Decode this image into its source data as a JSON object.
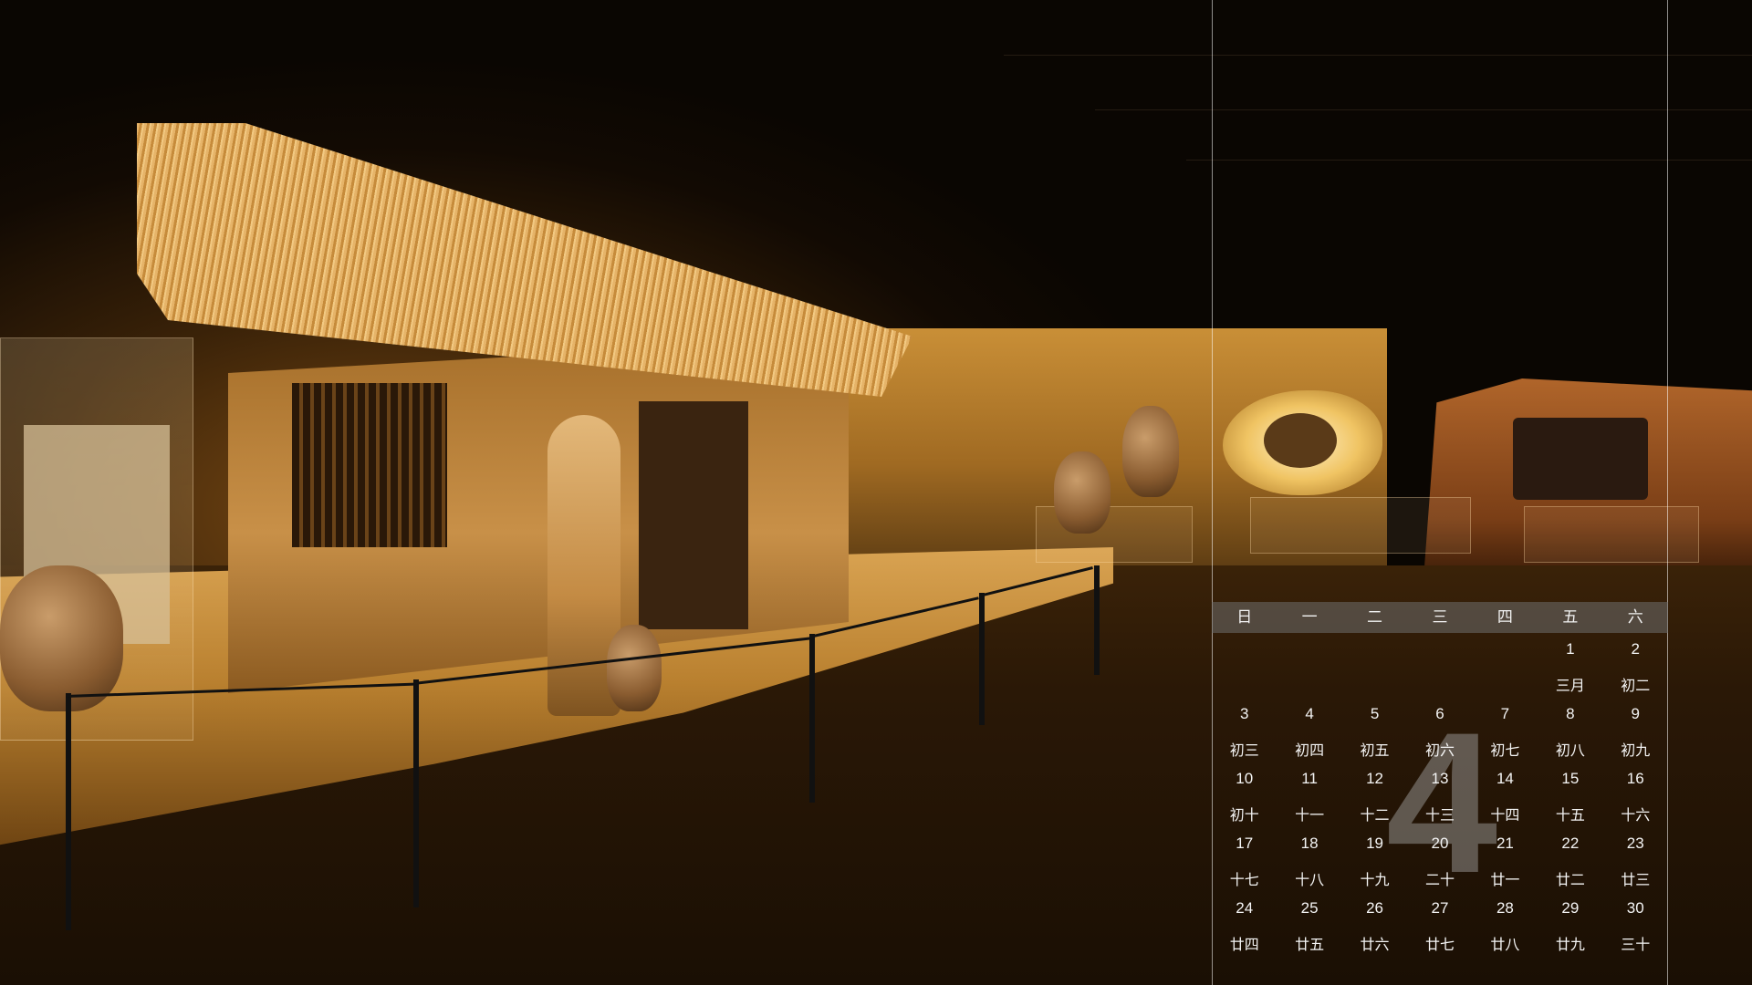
{
  "calendar": {
    "month_number": "4",
    "weekdays": [
      "日",
      "一",
      "二",
      "三",
      "四",
      "五",
      "六"
    ],
    "weeks": [
      [
        {
          "day": "",
          "lunar": ""
        },
        {
          "day": "",
          "lunar": ""
        },
        {
          "day": "",
          "lunar": ""
        },
        {
          "day": "",
          "lunar": ""
        },
        {
          "day": "",
          "lunar": ""
        },
        {
          "day": "1",
          "lunar": "三月"
        },
        {
          "day": "2",
          "lunar": "初二"
        }
      ],
      [
        {
          "day": "3",
          "lunar": "初三"
        },
        {
          "day": "4",
          "lunar": "初四"
        },
        {
          "day": "5",
          "lunar": "初五"
        },
        {
          "day": "6",
          "lunar": "初六"
        },
        {
          "day": "7",
          "lunar": "初七"
        },
        {
          "day": "8",
          "lunar": "初八"
        },
        {
          "day": "9",
          "lunar": "初九"
        }
      ],
      [
        {
          "day": "10",
          "lunar": "初十"
        },
        {
          "day": "11",
          "lunar": "十一"
        },
        {
          "day": "12",
          "lunar": "十二"
        },
        {
          "day": "13",
          "lunar": "十三"
        },
        {
          "day": "14",
          "lunar": "十四"
        },
        {
          "day": "15",
          "lunar": "十五"
        },
        {
          "day": "16",
          "lunar": "十六"
        }
      ],
      [
        {
          "day": "17",
          "lunar": "十七"
        },
        {
          "day": "18",
          "lunar": "十八"
        },
        {
          "day": "19",
          "lunar": "十九"
        },
        {
          "day": "20",
          "lunar": "二十"
        },
        {
          "day": "21",
          "lunar": "廿一"
        },
        {
          "day": "22",
          "lunar": "廿二"
        },
        {
          "day": "23",
          "lunar": "廿三"
        }
      ],
      [
        {
          "day": "24",
          "lunar": "廿四"
        },
        {
          "day": "25",
          "lunar": "廿五"
        },
        {
          "day": "26",
          "lunar": "廿六"
        },
        {
          "day": "27",
          "lunar": "廿七"
        },
        {
          "day": "28",
          "lunar": "廿八"
        },
        {
          "day": "29",
          "lunar": "廿九"
        },
        {
          "day": "30",
          "lunar": "三十"
        }
      ]
    ]
  },
  "colors": {
    "frame_line": "#ffffff",
    "weekday_bar": "#6e6e6e",
    "text": "#f4f4f4",
    "month_watermark": "#aaaaaa"
  }
}
